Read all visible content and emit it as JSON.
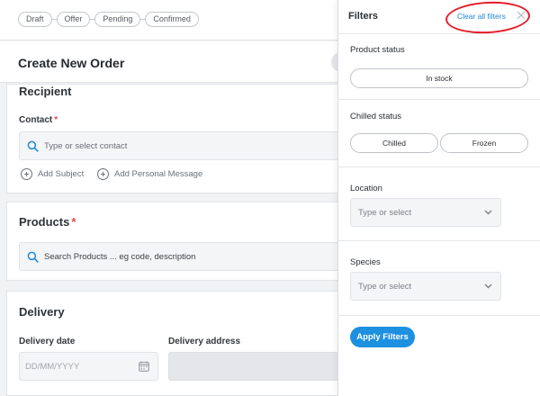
{
  "steps": [
    "Draft",
    "Offer",
    "Pending",
    "Confirmed"
  ],
  "page_title": "Create New Order",
  "recipient": {
    "title": "Recipient",
    "contact_label": "Contact",
    "contact_placeholder": "Type or select contact",
    "add_subject": "Add Subject",
    "add_message": "Add Personal Message"
  },
  "products": {
    "title": "Products",
    "search_placeholder": "Search Products ... eg code, description"
  },
  "delivery": {
    "title": "Delivery",
    "date_label": "Delivery date",
    "date_placeholder": "DD/MM/YYYY",
    "address_label": "Delivery address"
  },
  "filters": {
    "title": "Filters",
    "clear_all": "Clear all filters",
    "product_status": {
      "label": "Product status",
      "options": [
        "In stock"
      ]
    },
    "chilled_status": {
      "label": "Chilled status",
      "options": [
        "Chilled",
        "Frozen"
      ]
    },
    "location": {
      "label": "Location",
      "placeholder": "Type or select"
    },
    "species": {
      "label": "Species",
      "placeholder": "Type or select"
    },
    "apply": "Apply Filters"
  },
  "colors": {
    "accent": "#1e90e0",
    "link": "#1e88d6",
    "required": "#e5484d",
    "annotation": "#e41d2a"
  }
}
